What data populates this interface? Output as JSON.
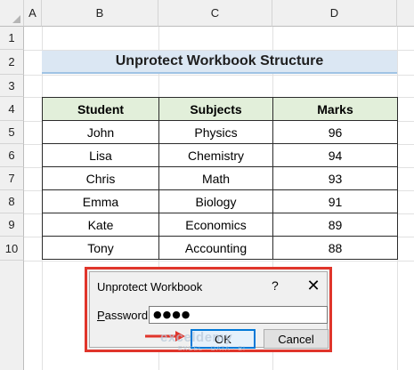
{
  "columns": [
    "A",
    "B",
    "C",
    "D"
  ],
  "rows": [
    "1",
    "2",
    "3",
    "4",
    "5",
    "6",
    "7",
    "8",
    "9",
    "10"
  ],
  "title": "Unprotect Workbook Structure",
  "table": {
    "headers": [
      "Student",
      "Subjects",
      "Marks"
    ],
    "rows": [
      [
        "John",
        "Physics",
        "96"
      ],
      [
        "Lisa",
        "Chemistry",
        "94"
      ],
      [
        "Chris",
        "Math",
        "93"
      ],
      [
        "Emma",
        "Biology",
        "91"
      ],
      [
        "Kate",
        "Economics",
        "89"
      ],
      [
        "Tony",
        "Accounting",
        "88"
      ]
    ]
  },
  "dialog": {
    "title": "Unprotect Workbook",
    "help": "?",
    "close": "✕",
    "password_label_prefix": "P",
    "password_label_rest": "assword:",
    "password_value": "●●●●",
    "ok_label": "OK",
    "cancel_label": "Cancel"
  },
  "watermark": {
    "brand": "exceldemy",
    "tagline": "EXCEL · DATA · BI"
  },
  "colors": {
    "title_fill": "#dbe7f3",
    "header_fill": "#e2efda",
    "highlight_red": "#e0352b"
  }
}
